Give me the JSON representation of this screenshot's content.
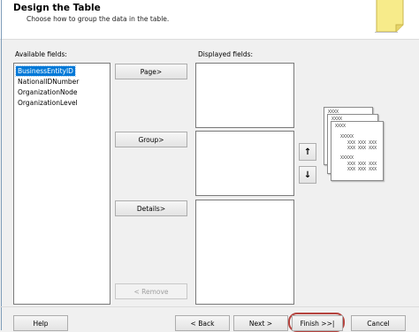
{
  "header": {
    "title": "Design the Table",
    "subtitle": "Choose how to group the data in the table."
  },
  "available_fields": {
    "label": "Available fields:",
    "items": [
      "BusinessEntityID",
      "NationalIDNumber",
      "OrganizationNode",
      "OrganizationLevel"
    ],
    "selected_index": 0
  },
  "displayed_fields": {
    "label": "Displayed fields:"
  },
  "move_buttons": {
    "page": "Page>",
    "group": "Group>",
    "details": "Details>",
    "remove": "< Remove"
  },
  "arrows": {
    "up": "↑",
    "down": "↓"
  },
  "preview": {
    "header_tokens": [
      "XXXX",
      "XXXX",
      "XXXX"
    ],
    "row1": "XXXXX",
    "row1_cells": "XXX XXX XXX",
    "row2": "XXXXX",
    "row2_cells": "XXX XXX XXX"
  },
  "footer": {
    "help": "Help",
    "back": "< Back",
    "next": "Next >",
    "finish": "Finish >>|",
    "cancel": "Cancel"
  },
  "colors": {
    "selection": "#0078d7",
    "highlight_ring": "#b5433e",
    "sticky_note": "#f7eb8a"
  }
}
